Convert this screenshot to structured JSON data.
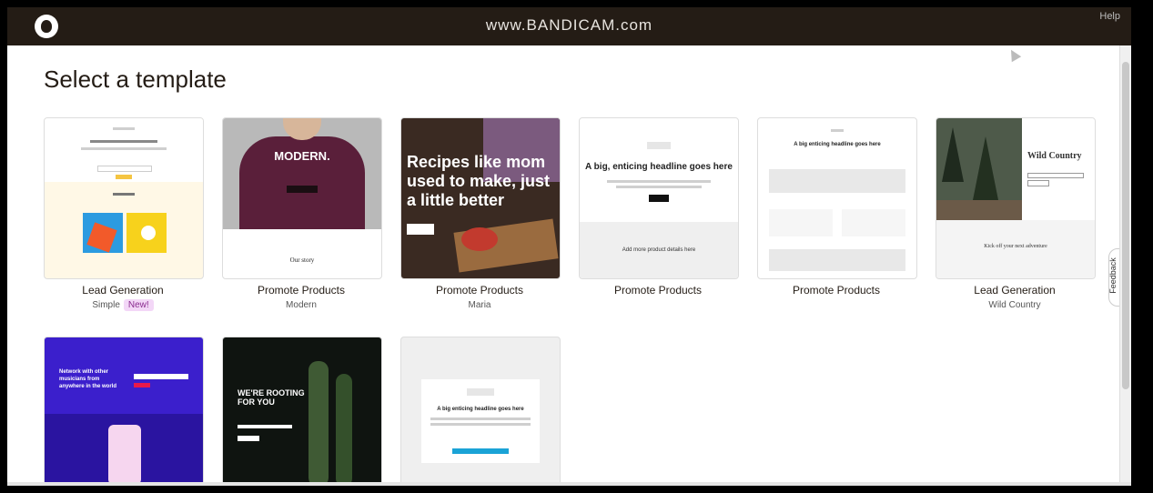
{
  "topbar": {
    "watermark": "www.BANDICAM.com",
    "help": "Help"
  },
  "page": {
    "title": "Select a template"
  },
  "feedback": "Feedback",
  "templates": [
    {
      "title": "Lead Generation",
      "subtitle": "Simple",
      "badge": "New!"
    },
    {
      "title": "Promote Products",
      "subtitle": "Modern",
      "preview_heading": "MODERN.",
      "preview_footer": "Our story"
    },
    {
      "title": "Promote Products",
      "subtitle": "Maria",
      "preview_heading": "Recipes like mom used to make, just a little better"
    },
    {
      "title": "Promote Products",
      "subtitle": "",
      "preview_heading": "A big, enticing headline goes here",
      "preview_footer": "Add more product details here"
    },
    {
      "title": "Promote Products",
      "subtitle": "",
      "preview_heading": "A big enticing headline goes here"
    },
    {
      "title": "Lead Generation",
      "subtitle": "Wild Country",
      "preview_heading": "Wild Country",
      "preview_footer": "Kick off your next adventure"
    },
    {
      "preview_heading": "Network with other musicians from anywhere in the world"
    },
    {
      "preview_heading": "WE'RE ROOTING FOR YOU"
    },
    {
      "preview_heading": "A big enticing headline goes here"
    }
  ],
  "colors": {
    "topbar": "#241c15",
    "purple": "#3b1fcc",
    "accent": "#ffe01b"
  }
}
